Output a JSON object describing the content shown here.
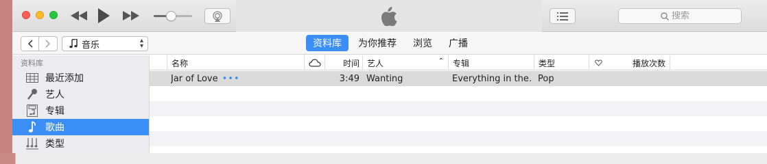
{
  "toolbar": {
    "search_placeholder": "搜索"
  },
  "navbar": {
    "media_kind": "音乐",
    "tabs": [
      {
        "label": "资料库",
        "active": true
      },
      {
        "label": "为你推荐",
        "active": false
      },
      {
        "label": "浏览",
        "active": false
      },
      {
        "label": "广播",
        "active": false
      }
    ]
  },
  "sidebar": {
    "section_title": "资料库",
    "items": [
      {
        "label": "最近添加",
        "icon": "grid-icon",
        "selected": false
      },
      {
        "label": "艺人",
        "icon": "microphone-icon",
        "selected": false
      },
      {
        "label": "专辑",
        "icon": "album-icon",
        "selected": false
      },
      {
        "label": "歌曲",
        "icon": "music-note-icon",
        "selected": true
      },
      {
        "label": "类型",
        "icon": "genre-icon",
        "selected": false
      }
    ]
  },
  "table": {
    "columns": {
      "name": "名称",
      "time": "时间",
      "artist": "艺人",
      "album": "专辑",
      "genre": "类型",
      "plays": "播放次数"
    },
    "rows": [
      {
        "name": "Jar of Love",
        "more": "•••",
        "time": "3:49",
        "artist": "Wanting",
        "album": "Everything in the…",
        "genre": "Pop"
      }
    ]
  },
  "colors": {
    "accent": "#3b8ef5",
    "close": "#fc5f57",
    "minimize": "#fdbc2e",
    "maximize": "#27c840"
  }
}
